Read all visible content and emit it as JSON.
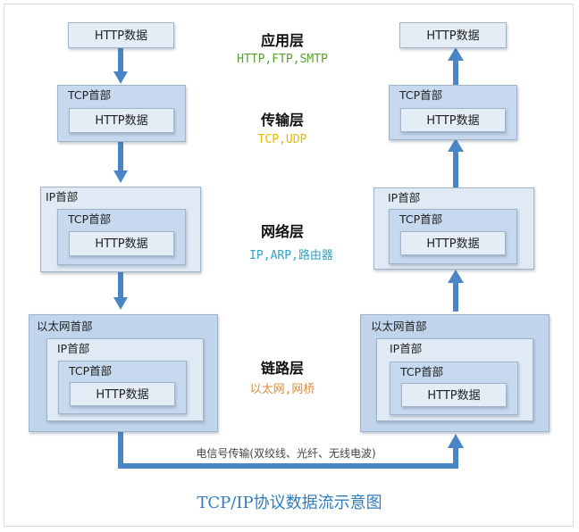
{
  "labels": {
    "http_data": "HTTP数据",
    "tcp_header": "TCP首部",
    "ip_header": "IP首部",
    "eth_header": "以太网首部"
  },
  "layers": [
    {
      "title": "应用层",
      "protocols": "HTTP,FTP,SMTP",
      "color": "#5aa02c"
    },
    {
      "title": "传输层",
      "protocols": "TCP,UDP",
      "color": "#e6b800"
    },
    {
      "title": "网络层",
      "protocols": "IP,ARP,路由器",
      "color": "#2aa6c9"
    },
    {
      "title": "链路层",
      "protocols": "以太网,网桥",
      "color": "#e08a3a"
    }
  ],
  "transmission_label": "电信号传输(双绞线、光纤、无线电波)",
  "caption": "TCP/IP协议数据流示意图",
  "colors": {
    "arrow": "#4a86c5",
    "caption": "#2e7dbf"
  }
}
